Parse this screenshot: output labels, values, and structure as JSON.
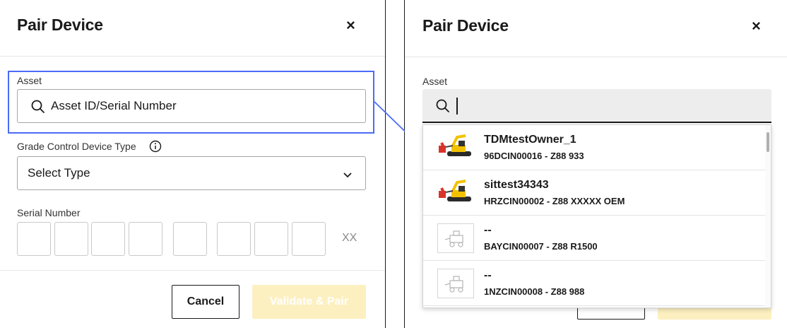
{
  "left": {
    "title": "Pair Device",
    "close_label": "×",
    "asset_label": "Asset",
    "asset_placeholder": "Asset ID/Serial Number",
    "type_label": "Grade Control Device Type",
    "info_icon": "info-icon",
    "type_select_value": "Select Type",
    "serial_label": "Serial Number",
    "serial_suffix": "XX",
    "cancel_label": "Cancel",
    "validate_label": "Validate & Pair"
  },
  "right": {
    "title": "Pair Device",
    "close_label": "×",
    "asset_label": "Asset",
    "search_value": "",
    "results": [
      {
        "name": "TDMtestOwner_1",
        "sub": "96DCIN00016 - Z88 933",
        "thumb": "excavator-image"
      },
      {
        "name": "sittest34343",
        "sub": "HRZCIN00002 - Z88 XXXXX OEM",
        "thumb": "excavator-image"
      },
      {
        "name": "--",
        "sub": "BAYCIN00007 - Z88 R1500",
        "thumb": "placeholder-machine-icon"
      },
      {
        "name": "--",
        "sub": "1NZCIN00008 - Z88 988",
        "thumb": "placeholder-machine-icon"
      }
    ]
  },
  "colors": {
    "highlight": "#4a6cf7",
    "primary_disabled": "#fdf0c0",
    "machine_yellow": "#f2c200",
    "machine_red": "#d9342b"
  }
}
